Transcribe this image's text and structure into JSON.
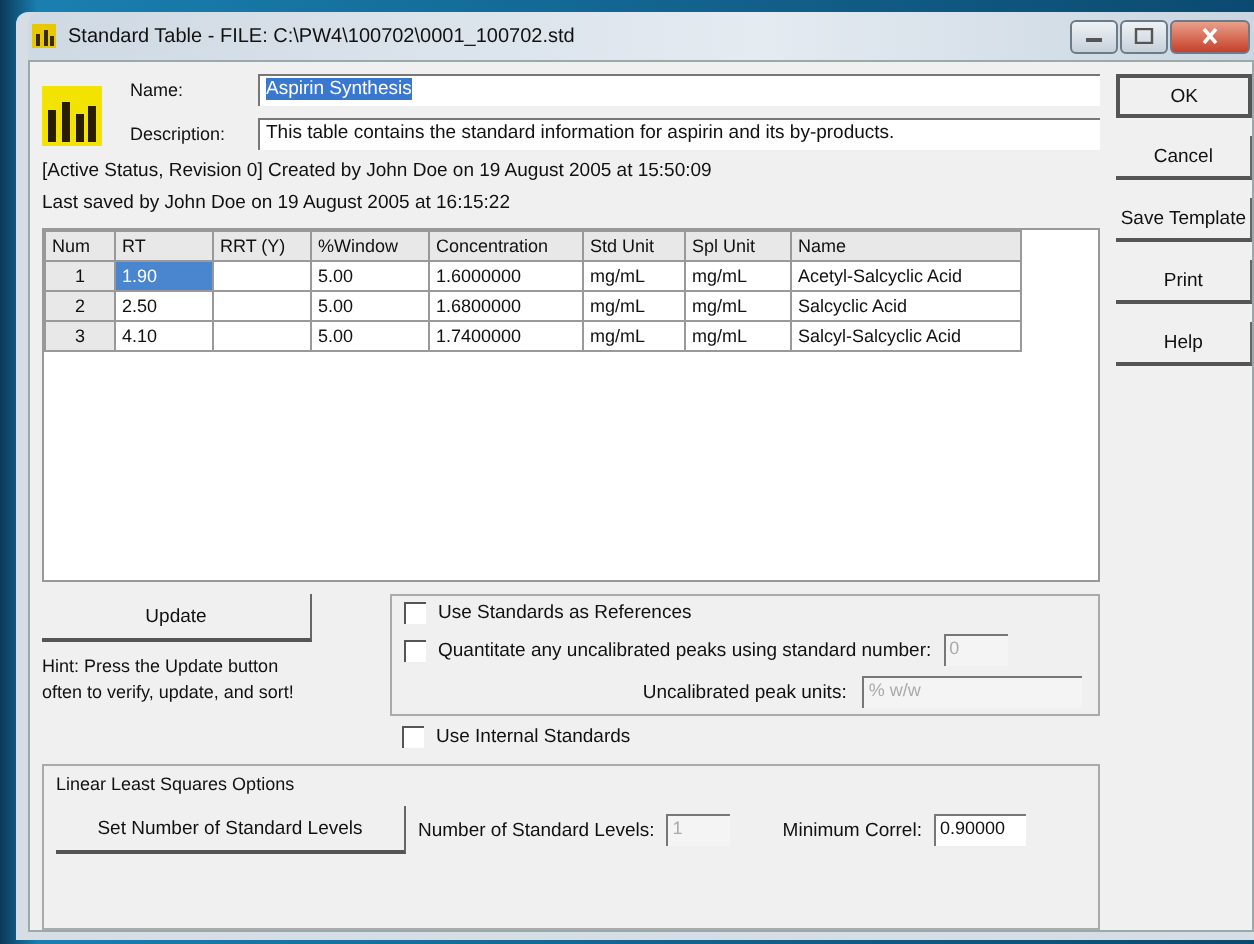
{
  "window": {
    "title": "Standard Table - FILE: C:\\PW4\\100702\\0001_100702.std"
  },
  "header": {
    "name_label": "Name:",
    "name_value": "Aspirin Synthesis",
    "name_text_selected": true,
    "description_label": "Description:",
    "description_value": "This table contains the standard information for aspirin and its by-products.",
    "status_lines": [
      "[Active Status, Revision 0] Created by John Doe on 19 August 2005 at 15:50:09",
      "Last saved by John Doe on 19 August 2005 at 16:15:22"
    ]
  },
  "buttons": [
    "OK",
    "Cancel",
    "Save Template",
    "Print",
    "Help"
  ],
  "table": {
    "columns": [
      "Num",
      "RT",
      "RRT (Y)",
      "%Window",
      "Concentration",
      "Std Unit",
      "Spl Unit",
      "Name"
    ],
    "rows": [
      {
        "cells": [
          "1",
          "1.90",
          "",
          "5.00",
          "1.6000000",
          "mg/mL",
          "mg/mL",
          "Acetyl-Salcyclic Acid"
        ],
        "selected": true
      },
      {
        "cells": [
          "2",
          "2.50",
          "",
          "5.00",
          "1.6800000",
          "mg/mL",
          "mg/mL",
          "Salcyclic Acid"
        ],
        "selected": false
      },
      {
        "cells": [
          "3",
          "4.10",
          "",
          "5.00",
          "1.7400000",
          "mg/mL",
          "mg/mL",
          "Salcyl-Salcyclic Acid"
        ],
        "selected": false
      }
    ]
  },
  "update_button": "Update",
  "hint": "Hint: Press the Update button often to verify, update, and sort!",
  "options": [
    {
      "label": "Use Standards as References",
      "checked": false
    },
    {
      "label": "Quantitate any uncalibrated peaks using standard number:",
      "checked": false,
      "field_value": "0",
      "field_disabled": true
    }
  ],
  "uncalibrated_units": {
    "label": "Uncalibrated peak units:",
    "value": "% w/w",
    "disabled": true
  },
  "internal_standards": {
    "label": "Use Internal Standards",
    "checked": false
  },
  "least_squares": {
    "title": "Linear Least Squares Options",
    "button": "Set Number of Standard Levels",
    "levels_label": "Number of Standard Levels:",
    "levels_value": "1",
    "levels_disabled": true,
    "correl_label": "Minimum Correl:",
    "correl_value": "0.90000"
  }
}
